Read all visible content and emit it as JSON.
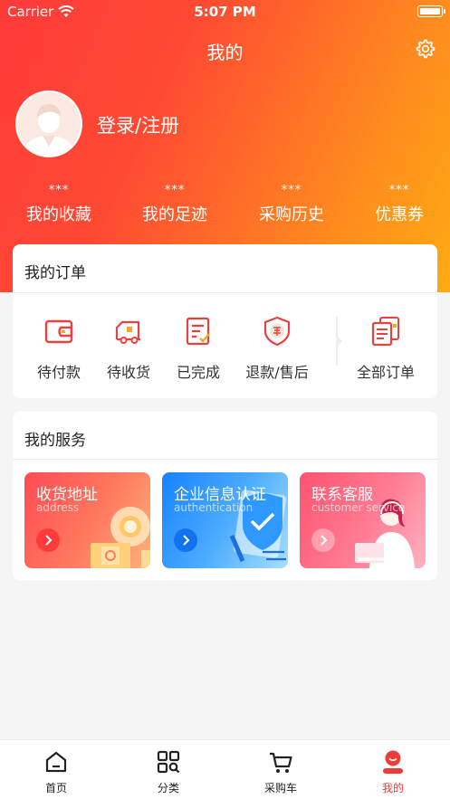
{
  "status_bar": {
    "carrier": "Carrier",
    "time": "5:07 PM"
  },
  "header": {
    "title": "我的"
  },
  "profile": {
    "login_label": "登录/注册"
  },
  "stats": [
    {
      "value": "***",
      "label": "我的收藏"
    },
    {
      "value": "***",
      "label": "我的足迹"
    },
    {
      "value": "***",
      "label": "采购历史"
    },
    {
      "value": "***",
      "label": "优惠券"
    }
  ],
  "orders": {
    "title": "我的订单",
    "items": [
      {
        "label": "待付款",
        "icon": "wallet-icon"
      },
      {
        "label": "待收货",
        "icon": "delivery-truck-icon"
      },
      {
        "label": "已完成",
        "icon": "completed-document-icon"
      },
      {
        "label": "退款/售后",
        "icon": "after-sale-shield-icon"
      }
    ],
    "all_label": "全部订单"
  },
  "services": {
    "title": "我的服务",
    "items": [
      {
        "title": "收货地址",
        "subtitle": "address",
        "color_from": "#ff4b55",
        "color_to": "#ff9b6a"
      },
      {
        "title": "企业信息认证",
        "subtitle": "authentication",
        "color_from": "#1a8bff",
        "color_to": "#7fd0ff"
      },
      {
        "title": "联系客服",
        "subtitle": "customer service",
        "color_from": "#ff5a72",
        "color_to": "#ffa2b6"
      }
    ]
  },
  "tabbar": [
    {
      "label": "首页",
      "icon": "home-icon",
      "active": false
    },
    {
      "label": "分类",
      "icon": "category-scan-icon",
      "active": false
    },
    {
      "label": "采购车",
      "icon": "cart-icon",
      "active": false
    },
    {
      "label": "我的",
      "icon": "profile-icon",
      "active": true
    }
  ],
  "colors": {
    "accent": "#ef3a3a",
    "header_start": "#ff3a3a",
    "header_end": "#ffab12"
  }
}
